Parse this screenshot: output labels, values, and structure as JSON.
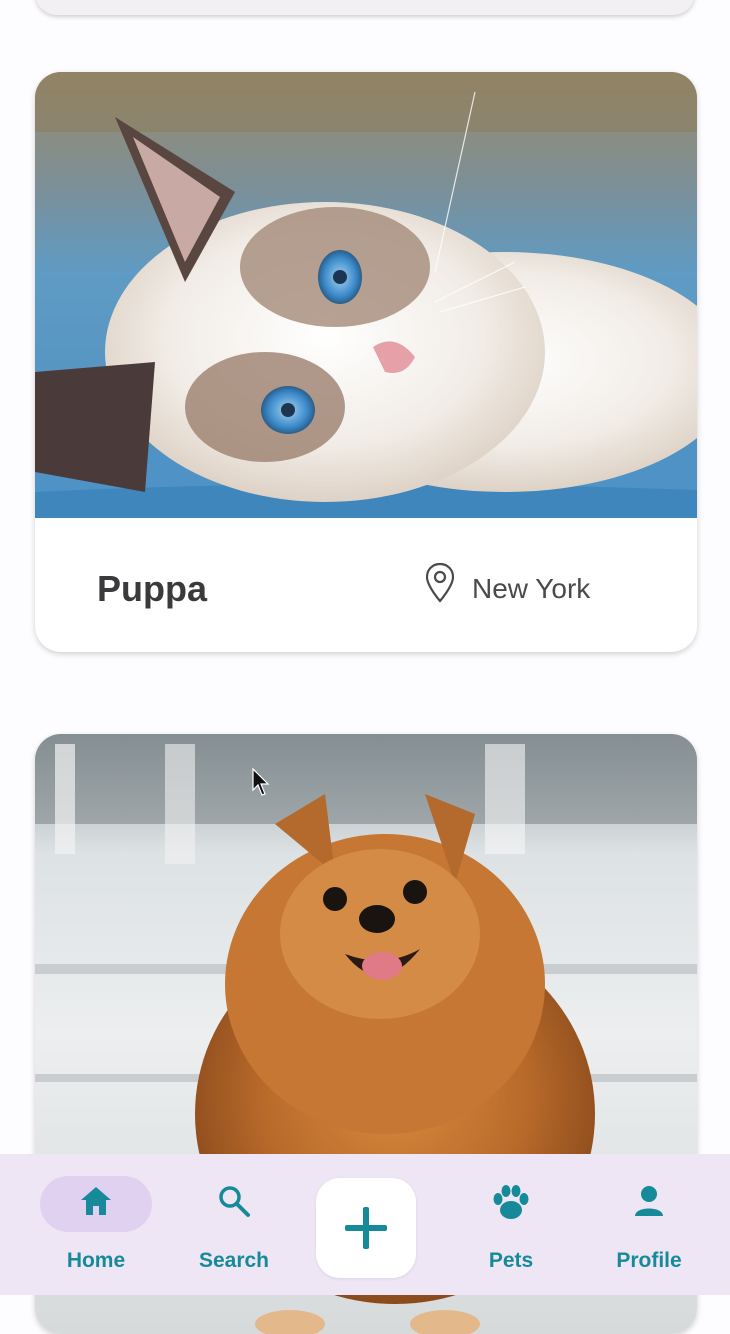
{
  "pets": [
    {
      "name": "Puppa",
      "location": "New York",
      "photo": "ragdoll-kitten-photo"
    },
    {
      "photo": "pomeranian-dog-photo"
    }
  ],
  "nav": {
    "items": [
      {
        "label": "Home",
        "icon": "home-icon",
        "active": true
      },
      {
        "label": "Search",
        "icon": "search-icon"
      },
      {
        "label": "Pets",
        "icon": "paw-icon"
      },
      {
        "label": "Profile",
        "icon": "person-icon"
      }
    ],
    "add_icon": "plus-icon"
  },
  "colors": {
    "accent": "#168a99",
    "nav_background": "#efe6f5",
    "active_pill": "#e1d1f1"
  }
}
